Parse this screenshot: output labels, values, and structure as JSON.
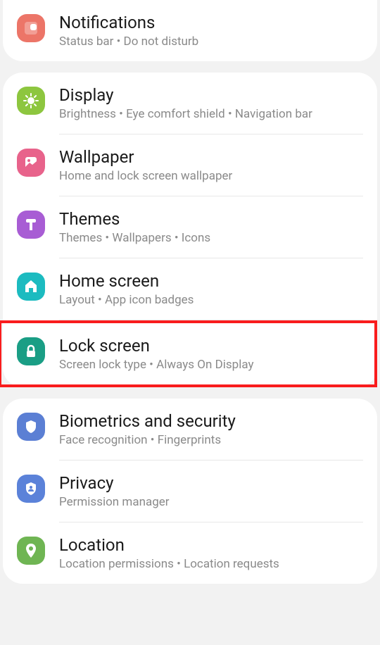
{
  "groups": [
    {
      "items": [
        {
          "id": "notifications",
          "title": "Notifications",
          "subtitle": "Status bar  •  Do not disturb",
          "iconColor": "bg-red-orange",
          "iconName": "notifications-icon"
        }
      ]
    },
    {
      "items": [
        {
          "id": "display",
          "title": "Display",
          "subtitle": "Brightness  •  Eye comfort shield  •  Navigation bar",
          "iconColor": "bg-green",
          "iconName": "display-icon"
        },
        {
          "id": "wallpaper",
          "title": "Wallpaper",
          "subtitle": "Home and lock screen wallpaper",
          "iconColor": "bg-pink",
          "iconName": "wallpaper-icon"
        },
        {
          "id": "themes",
          "title": "Themes",
          "subtitle": "Themes  •  Wallpapers  •  Icons",
          "iconColor": "bg-purple",
          "iconName": "themes-icon"
        },
        {
          "id": "home-screen",
          "title": "Home screen",
          "subtitle": "Layout  •  App icon badges",
          "iconColor": "bg-teal",
          "iconName": "home-icon"
        },
        {
          "id": "lock-screen",
          "title": "Lock screen",
          "subtitle": "Screen lock type  •  Always On Display",
          "iconColor": "bg-dark-teal",
          "iconName": "lock-icon",
          "highlighted": true
        }
      ]
    },
    {
      "items": [
        {
          "id": "biometrics",
          "title": "Biometrics and security",
          "subtitle": "Face recognition  •  Fingerprints",
          "iconColor": "bg-blue",
          "iconName": "shield-icon"
        },
        {
          "id": "privacy",
          "title": "Privacy",
          "subtitle": "Permission manager",
          "iconColor": "bg-blue2",
          "iconName": "privacy-icon"
        },
        {
          "id": "location",
          "title": "Location",
          "subtitle": "Location permissions  •  Location requests",
          "iconColor": "bg-green2",
          "iconName": "location-icon"
        }
      ]
    }
  ]
}
